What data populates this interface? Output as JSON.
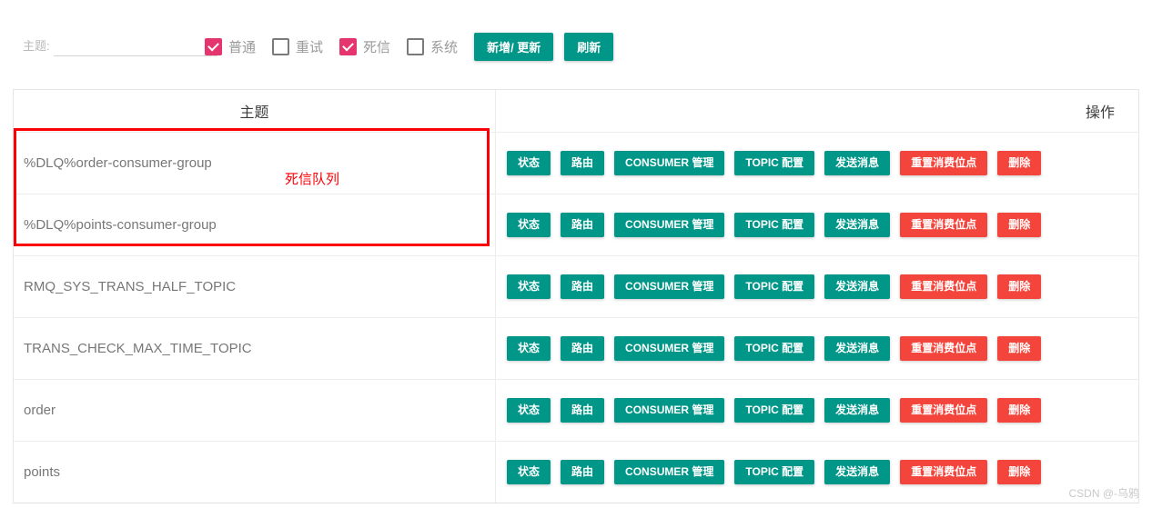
{
  "toolbar": {
    "filter": {
      "label": "主题:",
      "value": "",
      "placeholder": ""
    },
    "checkboxes": [
      {
        "label": "普通",
        "checked": true
      },
      {
        "label": "重试",
        "checked": false
      },
      {
        "label": "死信",
        "checked": true
      },
      {
        "label": "系统",
        "checked": false
      }
    ],
    "buttons": [
      {
        "label": "新增/ 更新",
        "style": "primary"
      },
      {
        "label": "刷新",
        "style": "primary"
      }
    ]
  },
  "table": {
    "headers": {
      "topic": "主题",
      "operations": "操作"
    },
    "operation_buttons": [
      {
        "label": "状态",
        "style": "primary"
      },
      {
        "label": "路由",
        "style": "primary"
      },
      {
        "label": "CONSUMER 管理",
        "style": "primary"
      },
      {
        "label": "TOPIC 配置",
        "style": "primary"
      },
      {
        "label": "发送消息",
        "style": "primary"
      },
      {
        "label": "重置消费位点",
        "style": "danger"
      },
      {
        "label": "删除",
        "style": "danger"
      }
    ],
    "rows": [
      {
        "topic": "%DLQ%order-consumer-group"
      },
      {
        "topic": "%DLQ%points-consumer-group"
      },
      {
        "topic": "RMQ_SYS_TRANS_HALF_TOPIC"
      },
      {
        "topic": "TRANS_CHECK_MAX_TIME_TOPIC"
      },
      {
        "topic": "order"
      },
      {
        "topic": "points"
      }
    ]
  },
  "annotation": {
    "label": "死信队列",
    "color": "#fb0007"
  },
  "watermark": {
    "text": "CSDN @-乌鸦"
  },
  "colors": {
    "primary": "#009688",
    "danger": "#f4453c",
    "checkbox_checked": "#e5356f",
    "annotation": "#fb0007"
  }
}
